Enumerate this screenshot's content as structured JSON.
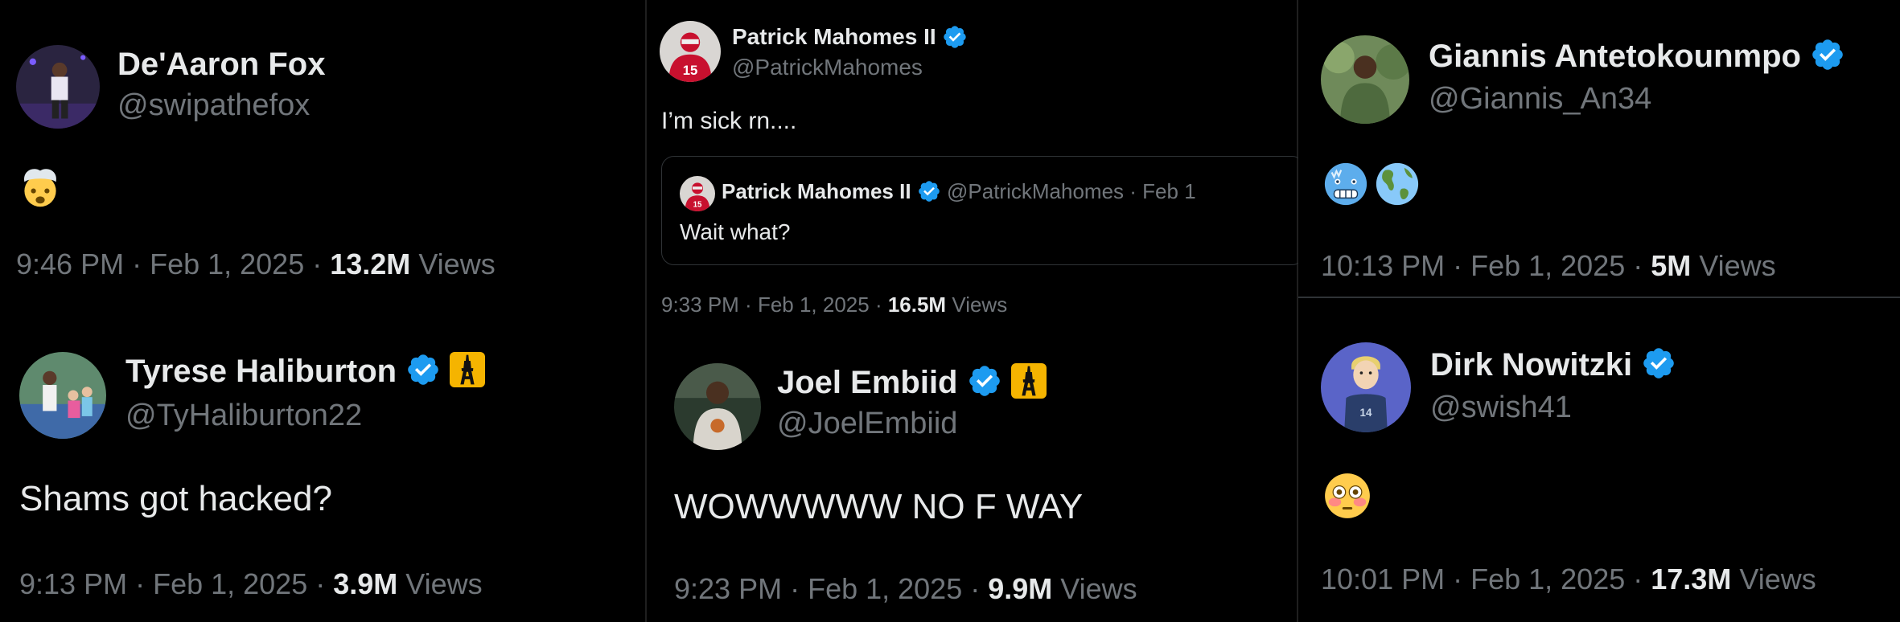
{
  "tweets": {
    "fox": {
      "display_name": "De'Aaron Fox",
      "handle": "@swipathefox",
      "content_emoji": "exploding-head-emoji",
      "time": "9:46 PM",
      "date": "Feb 1, 2025",
      "views_count": "13.2M",
      "views_label": "Views"
    },
    "haliburton": {
      "display_name": "Tyrese Haliburton",
      "handle": "@TyHaliburton22",
      "text": "Shams got hacked?",
      "time": "9:13 PM",
      "date": "Feb 1, 2025",
      "views_count": "3.9M",
      "views_label": "Views"
    },
    "mahomes": {
      "display_name": "Patrick Mahomes II",
      "handle": "@PatrickMahomes",
      "text": "I’m sick rn....",
      "quote": {
        "display_name": "Patrick Mahomes II",
        "handle": "@PatrickMahomes",
        "date": "Feb 1",
        "text": "Wait what?"
      },
      "time": "9:33 PM",
      "date": "Feb 1, 2025",
      "views_count": "16.5M",
      "views_label": "Views"
    },
    "embiid": {
      "display_name": "Joel Embiid",
      "handle": "@JoelEmbiid",
      "text": "WOWWWWW NO F WAY",
      "time": "9:23 PM",
      "date": "Feb 1, 2025",
      "views_count": "9.9M",
      "views_label": "Views"
    },
    "giannis": {
      "display_name": "Giannis Antetokounmpo",
      "handle": "@Giannis_An34",
      "content_emoji": [
        "cold-face-emoji",
        "globe-americas-emoji"
      ],
      "time": "10:13 PM",
      "date": "Feb 1, 2025",
      "views_count": "5M",
      "views_label": "Views"
    },
    "nowitzki": {
      "display_name": "Dirk Nowitzki",
      "handle": "@swish41",
      "content_emoji": "flushed-face-emoji",
      "time": "10:01 PM",
      "date": "Feb 1, 2025",
      "views_count": "17.3M",
      "views_label": "Views"
    }
  },
  "colors": {
    "background": "#000000",
    "text": "#e7e9ea",
    "secondary": "#71767b",
    "verified": "#1d9bf0",
    "eiffel_badge": "#f5b400",
    "border": "#2f3336"
  }
}
